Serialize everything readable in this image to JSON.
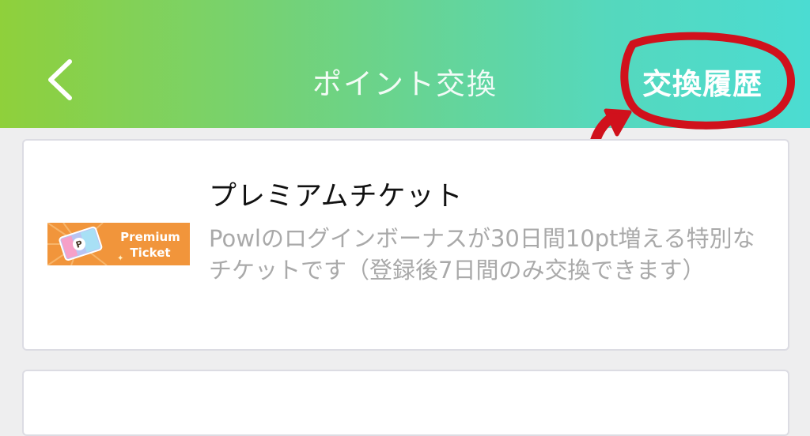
{
  "header": {
    "title": "ポイント交換",
    "history_label": "交換履歴",
    "back_icon": "chevron-left-icon",
    "gradient": [
      "#8fd03b",
      "#4bdcd2"
    ]
  },
  "annotation": {
    "color": "#d0111c"
  },
  "items": [
    {
      "title": "プレミアムチケット",
      "description": "Powlのログインボーナスが30日間10pt増える特別なチケットです（登録後7日間のみ交換できます）",
      "ticket_text_1": "Premium",
      "ticket_text_2": "Ticket",
      "ticket_logo": "P"
    }
  ]
}
